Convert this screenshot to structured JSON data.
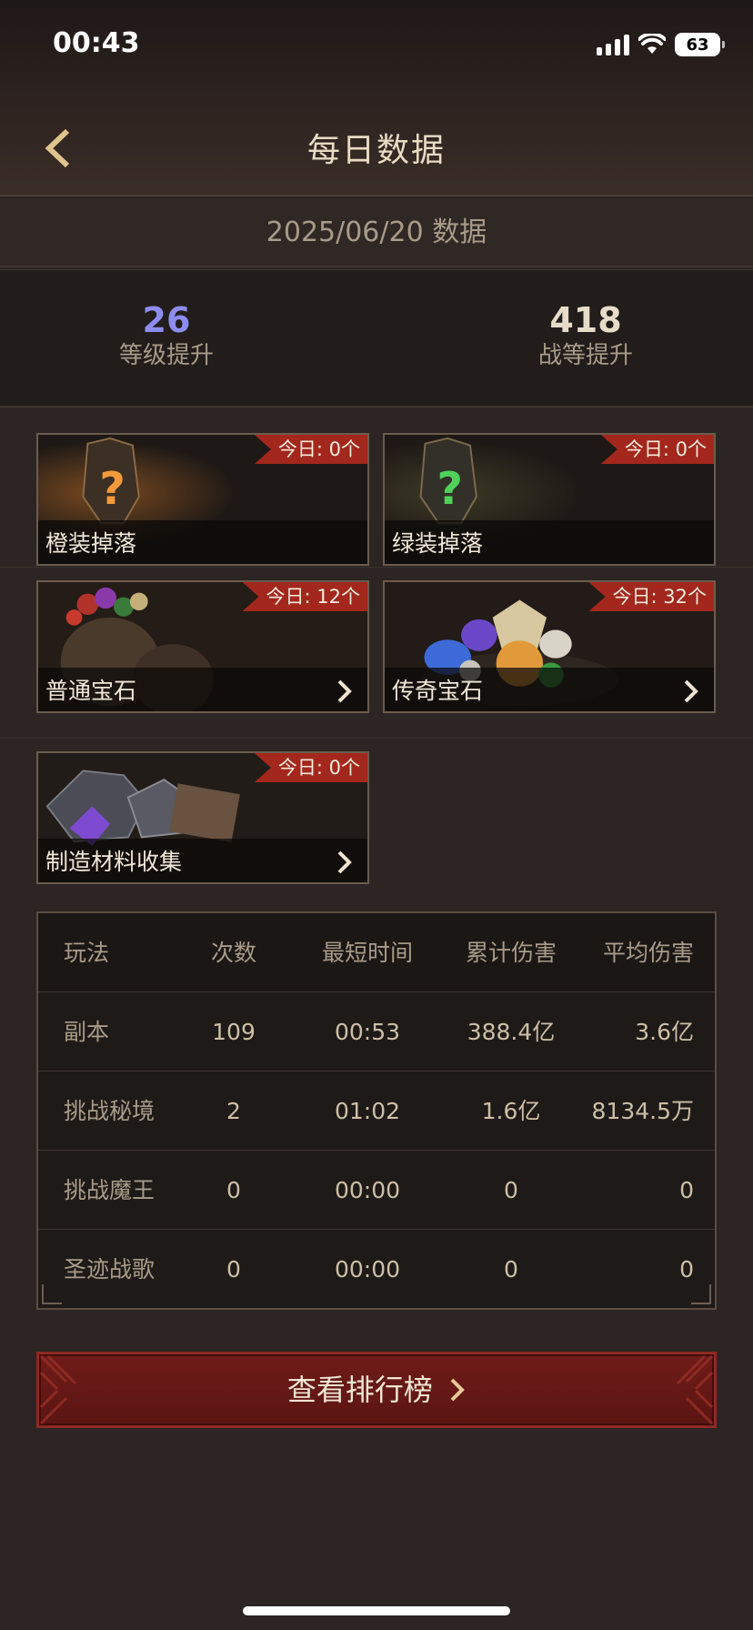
{
  "status_bar": {
    "time": "00:43",
    "battery": "63"
  },
  "header": {
    "title": "每日数据",
    "back_icon": "chevron-left-icon"
  },
  "date_bar": {
    "text": "2025/06/20 数据"
  },
  "stats": {
    "level": {
      "value": "26",
      "label": "等级提升",
      "color": "#8d8cf0"
    },
    "power": {
      "value": "418",
      "label": "战等提升",
      "color": "#e6dcc8"
    }
  },
  "cards": [
    {
      "label": "橙装掉落",
      "badge": "今日: 0个",
      "icon": "orange-mystery-item-icon",
      "has_arrow": false
    },
    {
      "label": "绿装掉落",
      "badge": "今日: 0个",
      "icon": "green-mystery-item-icon",
      "has_arrow": false
    },
    {
      "label": "普通宝石",
      "badge": "今日: 12个",
      "icon": "gem-pouch-icon",
      "has_arrow": true
    },
    {
      "label": "传奇宝石",
      "badge": "今日: 32个",
      "icon": "legendary-gems-icon",
      "has_arrow": true
    },
    {
      "label": "制造材料收集",
      "badge": "今日: 0个",
      "icon": "crafting-materials-icon",
      "has_arrow": true
    }
  ],
  "table": {
    "headers": [
      "玩法",
      "次数",
      "最短时间",
      "累计伤害",
      "平均伤害"
    ],
    "rows": [
      [
        "副本",
        "109",
        "00:53",
        "388.4亿",
        "3.6亿"
      ],
      [
        "挑战秘境",
        "2",
        "01:02",
        "1.6亿",
        "8134.5万"
      ],
      [
        "挑战魔王",
        "0",
        "00:00",
        "0",
        "0"
      ],
      [
        "圣迹战歌",
        "0",
        "00:00",
        "0",
        "0"
      ]
    ]
  },
  "leaderboard_button": {
    "label": "查看排行榜"
  },
  "colors": {
    "accent_red": "#a3271c",
    "button_red": "#701c18",
    "text_gold": "#d8cbb4",
    "background": "#2c2523"
  }
}
